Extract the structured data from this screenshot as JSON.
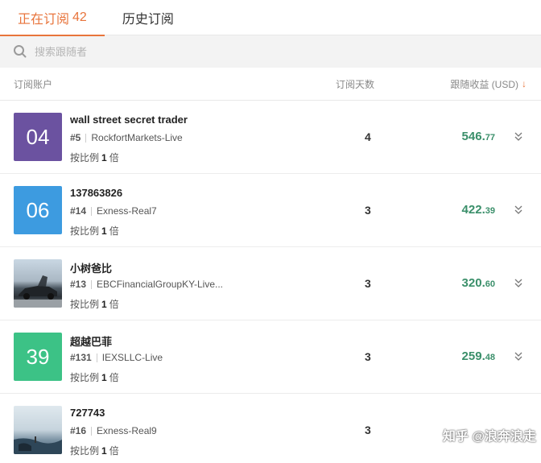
{
  "tabs": [
    {
      "label": "正在订阅",
      "count": "42"
    },
    {
      "label": "历史订阅"
    }
  ],
  "search": {
    "placeholder": "搜索跟随者"
  },
  "table": {
    "headers": {
      "account": "订阅账户",
      "days": "订阅天数",
      "profit": "跟随收益 (USD)",
      "sort_icon": "arrow-down"
    }
  },
  "rows": [
    {
      "avatar_text": "04",
      "avatar_color": "#6b52a0",
      "name": "wall street secret trader",
      "rank": "#5",
      "broker": "RockfortMarkets-Live",
      "ratio_prefix": "按比例",
      "ratio_value": "1",
      "ratio_suffix": "倍",
      "days": "4",
      "profit_int": "546.",
      "profit_dec": "77"
    },
    {
      "avatar_text": "06",
      "avatar_color": "#3d9be0",
      "name": "137863826",
      "rank": "#14",
      "broker": "Exness-Real7",
      "ratio_prefix": "按比例",
      "ratio_value": "1",
      "ratio_suffix": "倍",
      "days": "3",
      "profit_int": "422.",
      "profit_dec": "39"
    },
    {
      "avatar_text": "",
      "avatar_image": "car-photo",
      "name": "小树爸比",
      "rank": "#13",
      "broker": "EBCFinancialGroupKY-Live...",
      "ratio_prefix": "按比例",
      "ratio_value": "1",
      "ratio_suffix": "倍",
      "days": "3",
      "profit_int": "320.",
      "profit_dec": "60"
    },
    {
      "avatar_text": "39",
      "avatar_color": "#3cc286",
      "name": "超越巴菲",
      "rank": "#131",
      "broker": "IEXSLLC-Live",
      "ratio_prefix": "按比例",
      "ratio_value": "1",
      "ratio_suffix": "倍",
      "days": "3",
      "profit_int": "259.",
      "profit_dec": "48"
    },
    {
      "avatar_text": "",
      "avatar_image": "sea-photo",
      "name": "727743",
      "rank": "#16",
      "broker": "Exness-Real9",
      "ratio_prefix": "按比例",
      "ratio_value": "1",
      "ratio_suffix": "倍",
      "days": "3",
      "profit_int": "",
      "profit_dec": ""
    }
  ],
  "watermark": "知乎 @浪奔浪走",
  "colors": {
    "accent": "#e8743b",
    "profit_green": "#3a8f6a"
  }
}
